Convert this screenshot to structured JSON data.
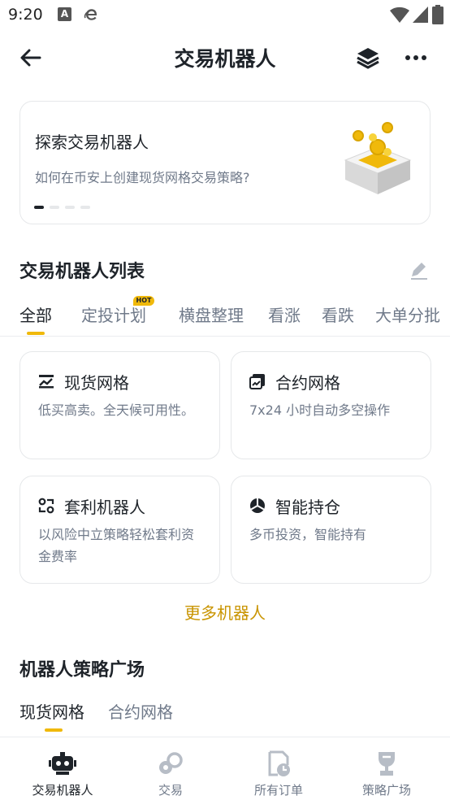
{
  "status_bar": {
    "time": "9:20",
    "app_icon_letter": "A"
  },
  "header": {
    "title": "交易机器人"
  },
  "banner": {
    "title": "探索交易机器人",
    "subtitle": "如何在币安上创建现货网格交易策略?",
    "pages": 4,
    "active_page": 1
  },
  "bots_section": {
    "title": "交易机器人列表",
    "tabs": [
      {
        "label": "全部",
        "active": true
      },
      {
        "label": "定投计划",
        "badge": "HOT"
      },
      {
        "label": "横盘整理"
      },
      {
        "label": "看涨"
      },
      {
        "label": "看跌"
      },
      {
        "label": "大单分批"
      }
    ],
    "cards": [
      {
        "name": "现货网格",
        "desc": "低买高卖。全天候可用性。",
        "icon": "spot-grid-icon"
      },
      {
        "name": "合约网格",
        "desc": "7x24 小时自动多空操作",
        "icon": "futures-grid-icon"
      },
      {
        "name": "套利机器人",
        "desc": "以风险中立策略轻松套利资金费率",
        "icon": "arbitrage-icon"
      },
      {
        "name": "智能持仓",
        "desc": "多币投资，智能持有",
        "icon": "rebalancing-icon"
      }
    ],
    "more_label": "更多机器人"
  },
  "strategy_section": {
    "title": "机器人策略广场",
    "tabs": [
      {
        "label": "现货网格",
        "active": true
      },
      {
        "label": "合约网格"
      }
    ]
  },
  "bottom_nav": [
    {
      "label": "交易机器人",
      "icon": "robot-icon",
      "active": true
    },
    {
      "label": "交易",
      "icon": "trade-icon"
    },
    {
      "label": "所有订单",
      "icon": "orders-icon"
    },
    {
      "label": "策略广场",
      "icon": "trophy-icon"
    }
  ],
  "colors": {
    "accent": "#f0b90b",
    "accent_text": "#c99400",
    "text": "#1e2329",
    "muted": "#707a8a",
    "border": "#e6e8ea"
  }
}
